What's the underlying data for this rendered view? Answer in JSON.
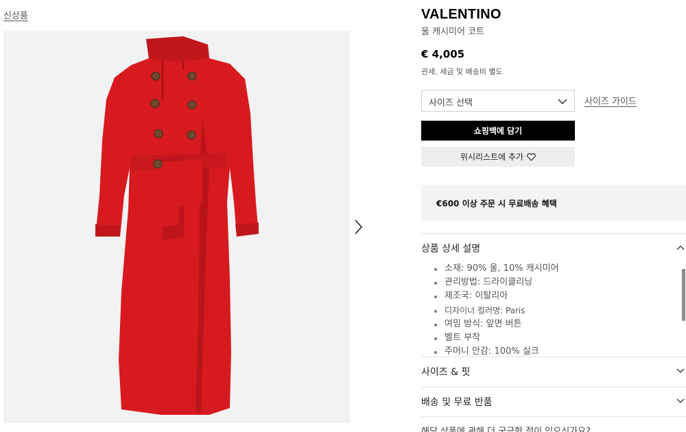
{
  "breadcrumb": {
    "label": "신상품"
  },
  "product": {
    "brand": "VALENTINO",
    "name": "울 캐시미어 코트",
    "price": "€ 4,005",
    "tax_note": "관세, 세금 및 배송비 별도"
  },
  "actions": {
    "size_select_label": "사이즈 선택",
    "size_guide_label": "사이즈 가이드",
    "add_to_bag_label": "쇼핑백에 담기",
    "wishlist_label": "위시리스트에 추가"
  },
  "promo": {
    "text": "€600 이상 주문 시 무료배송 혜택"
  },
  "accordion": {
    "details": {
      "title": "상품 상세 설명",
      "items": [
        "소재: 90% 울, 10% 캐시미어",
        "관리방법: 드라이클리닝",
        "제조국: 이탈리아",
        "디자이너 컬러명: Paris",
        "여밈 방식: 앞면 버튼",
        "벨트 부착",
        "주머니 안감: 100% 실크"
      ]
    },
    "size_fit": {
      "title": "사이즈 & 핏"
    },
    "shipping": {
      "title": "배송 및 무료 반품"
    }
  },
  "footer_question": "해당 상품에 관해 더 궁금한 점이 있으신가요?",
  "colors": {
    "coat_red": "#d71a1f",
    "button_black": "#000000",
    "gallery_bg": "#f2f2f2"
  },
  "icons": [
    "chevron-right-icon",
    "chevron-down-icon",
    "chevron-up-icon",
    "heart-icon"
  ]
}
